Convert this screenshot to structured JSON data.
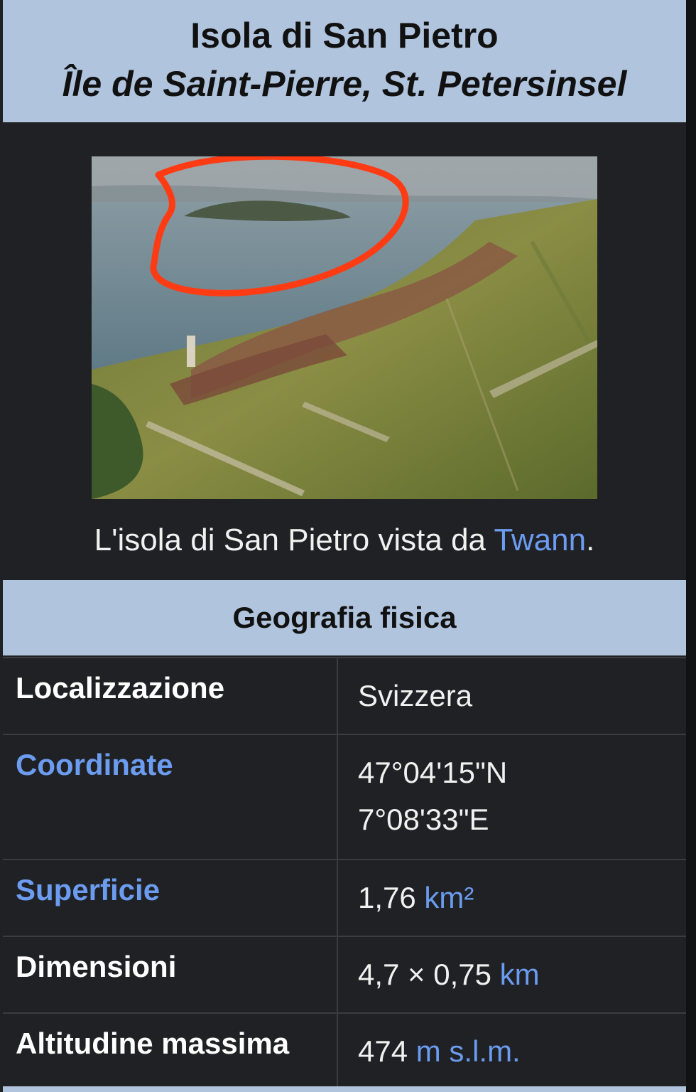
{
  "infobox": {
    "title": "Isola di San Pietro",
    "subtitle": "Île de Saint-Pierre, St. Petersinsel",
    "image": {
      "caption_prefix": "L'isola di San Pietro vista da ",
      "caption_link": "Twann",
      "caption_suffix": "."
    },
    "section_title": "Geografia fisica",
    "rows": [
      {
        "label": "Localizzazione",
        "value": "Svizzera"
      },
      {
        "label": "Coordinate",
        "value_line1": "47°04'15\"N",
        "value_line2": "7°08'33\"E"
      },
      {
        "label": "Superficie",
        "value": "1,76",
        "unit": "km²"
      },
      {
        "label": "Dimensioni",
        "value": "4,7 × 0,75",
        "unit": "km"
      },
      {
        "label": "Altitudine massima",
        "value": "474",
        "unit": "m s.l.m."
      }
    ]
  },
  "colors": {
    "header_bg": "#b0c4de",
    "body_bg": "#202124",
    "link": "#6b9cf0",
    "annotation": "#ff3b14"
  }
}
